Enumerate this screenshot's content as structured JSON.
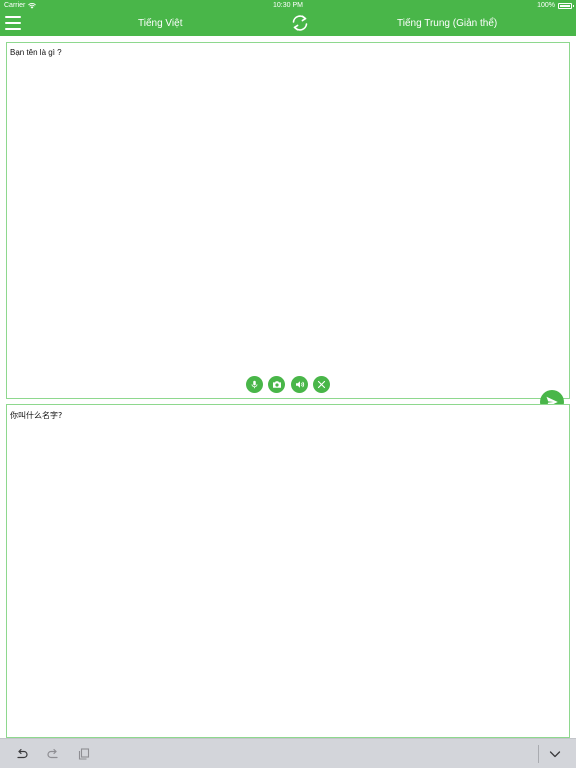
{
  "status_bar": {
    "carrier": "Carrier",
    "time": "10:30 PM",
    "battery": "100%",
    "battery_level": 1.0
  },
  "nav_bar": {
    "source_language": "Tiếng Việt",
    "target_language": "Tiếng Trung (Giản thể)"
  },
  "source": {
    "text": "Bạn tên là gì ?"
  },
  "result": {
    "text": "你叫什么名字?"
  },
  "icons": {
    "menu": "menu-icon",
    "swap": "swap-icon",
    "mic": "microphone-icon",
    "camera": "camera-icon",
    "speaker": "speaker-icon",
    "clear": "close-icon",
    "send": "send-icon",
    "undo": "undo-icon",
    "redo": "redo-icon",
    "paste": "paste-icon",
    "dismiss": "chevron-down-icon"
  },
  "colors": {
    "brand": "#49b649",
    "panel_border": "#8ed88e",
    "accessory_bar": "#d3d5da"
  }
}
